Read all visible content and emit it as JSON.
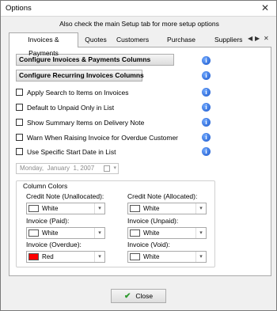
{
  "window": {
    "title": "Options",
    "close_glyph": "✕"
  },
  "hint": "Also check the main Setup tab for more setup options",
  "tabs": [
    {
      "label": "Invoices & Payments",
      "active": true
    },
    {
      "label": "Quotes"
    },
    {
      "label": "Customers"
    },
    {
      "label": "Purchase Orders"
    },
    {
      "label": "Suppliers"
    }
  ],
  "tab_nav": {
    "prev": "◀",
    "next": "▶",
    "close": "✕"
  },
  "buttons": {
    "configure_invoices": "Configure Invoices & Payments Columns",
    "configure_recurring": "Configure Recurring Invoices Columns",
    "close": "Close"
  },
  "info_glyph": "i",
  "options": [
    {
      "label": "Apply Search to Items on Invoices",
      "checked": false
    },
    {
      "label": "Default to Unpaid Only in List",
      "checked": false
    },
    {
      "label": "Show Summary Items on Delivery Note",
      "checked": false
    },
    {
      "label": "Warn When Raising Invoice for Overdue Customer",
      "checked": false
    },
    {
      "label": "Use Specific Start Date in List",
      "checked": false
    }
  ],
  "start_date": {
    "weekday": "Monday",
    "sep1": ",",
    "month": "January",
    "day": "1",
    "sep2": ",",
    "year": "2007"
  },
  "column_colors": {
    "title": "Column Colors",
    "items": [
      {
        "label": "Credit Note (Unallocated):",
        "value": "White",
        "color": "#ffffff"
      },
      {
        "label": "Credit Note (Allocated):",
        "value": "White",
        "color": "#ffffff"
      },
      {
        "label": "Invoice (Paid):",
        "value": "White",
        "color": "#ffffff"
      },
      {
        "label": "Invoice (Unpaid):",
        "value": "White",
        "color": "#ffffff"
      },
      {
        "label": "Invoice (Overdue):",
        "value": "Red",
        "color": "#ff0000"
      },
      {
        "label": "Invoice (Void):",
        "value": "White",
        "color": "#ffffff"
      }
    ]
  }
}
